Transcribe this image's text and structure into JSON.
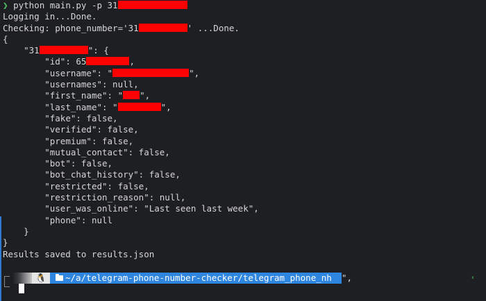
{
  "command": {
    "chevron": "❯",
    "text": "python main.py -p 31"
  },
  "log": {
    "login": "Logging in...Done.",
    "checking_prefix": "Checking: phone_number='31",
    "checking_suffix": "' ...Done."
  },
  "json_output": {
    "open_brace": "{",
    "key_prefix": "\"31",
    "key_suffix": "\": {",
    "id_prefix": "\"id\": 65",
    "id_suffix": ",",
    "username_prefix": "\"username\": \"",
    "username_suffix": "\",",
    "usernames": "\"usernames\": null,",
    "first_name_prefix": "\"first_name\": \"",
    "first_name_suffix": "\",",
    "last_name_prefix": "\"last_name\": \"",
    "last_name_suffix": "\",",
    "fake": "\"fake\": false,",
    "verified": "\"verified\": false,",
    "premium": "\"premium\": false,",
    "mutual_contact": "\"mutual_contact\": false,",
    "bot": "\"bot\": false,",
    "bot_chat_history": "\"bot_chat_history\": false,",
    "restricted": "\"restricted\": false,",
    "restriction_reason": "\"restriction_reason\": null,",
    "user_was_online": "\"user_was_online\": \"Last seen last week\",",
    "phone": "\"phone\": null",
    "inner_close": "}",
    "outer_close": "}"
  },
  "results": "Results saved to results.json",
  "prompt": {
    "os_icon": "linux-tux-icon",
    "os_glyph": "🐧",
    "path": "~/a/telegram-phone-number-checker/telegram_phone_nh",
    "tail": "\",",
    "right_chevron": "‹"
  },
  "colors": {
    "background": "#1e1f22",
    "text": "#d6d6d6",
    "prompt_green": "#58c66b",
    "path_blue": "#2f86e0",
    "redaction": "#ff0000"
  }
}
